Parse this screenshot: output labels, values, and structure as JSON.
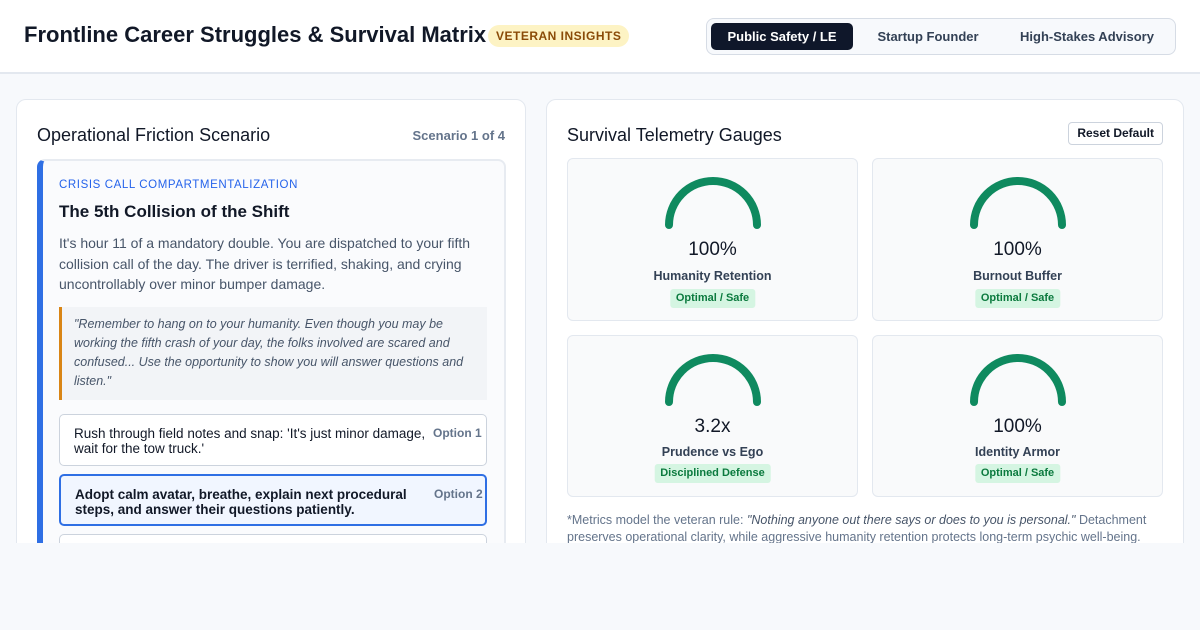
{
  "header": {
    "title": "Frontline Career Struggles & Survival Matrix",
    "badge": "VETERAN INSIGHTS",
    "tabs": [
      {
        "label": "Public Safety / LE",
        "active": true
      },
      {
        "label": "Startup Founder",
        "active": false
      },
      {
        "label": "High-Stakes Advisory",
        "active": false
      }
    ]
  },
  "scenario_panel": {
    "title": "Operational Friction Scenario",
    "counter": "Scenario 1 of 4",
    "category": "CRISIS CALL COMPARTMENTALIZATION",
    "heading": "The 5th Collision of the Shift",
    "description": "It's hour 11 of a mandatory double. You are dispatched to your fifth collision call of the day. The driver is terrified, shaking, and crying uncontrollably over minor bumper damage.",
    "quote": "\"Remember to hang on to your humanity. Even though you may be working the fifth crash of your day, the folks involved are scared and confused... Use the opportunity to show you will answer questions and listen.\"",
    "options": [
      {
        "text": "Rush through field notes and snap: 'It's just minor damage, wait for the tow truck.'",
        "label": "Option 1",
        "selected": false
      },
      {
        "text": "Adopt calm avatar, breathe, explain next procedural steps, and answer their questions patiently.",
        "label": "Option 2",
        "selected": true
      },
      {
        "text": "",
        "label": "",
        "selected": false
      }
    ]
  },
  "telemetry_panel": {
    "title": "Survival Telemetry Gauges",
    "reset_label": "Reset Default",
    "gauge_color": "#0f8a5f",
    "status_bg": "#d5f5e2",
    "status_color": "#0b7a3e",
    "gauges": [
      {
        "value": "100%",
        "label": "Humanity Retention",
        "status": "Optimal / Safe",
        "fill": 1.0
      },
      {
        "value": "100%",
        "label": "Burnout Buffer",
        "status": "Optimal / Safe",
        "fill": 1.0
      },
      {
        "value": "3.2x",
        "label": "Prudence vs Ego",
        "status": "Disciplined Defense",
        "fill": 1.0
      },
      {
        "value": "100%",
        "label": "Identity Armor",
        "status": "Optimal / Safe",
        "fill": 1.0
      }
    ],
    "footnote_prefix": "*Metrics model the veteran rule: ",
    "footnote_quote": "\"Nothing anyone out there says or does to you is personal.\"",
    "footnote_suffix": " Detachment preserves operational clarity, while aggressive humanity retention protects long-term psychic well-being."
  }
}
